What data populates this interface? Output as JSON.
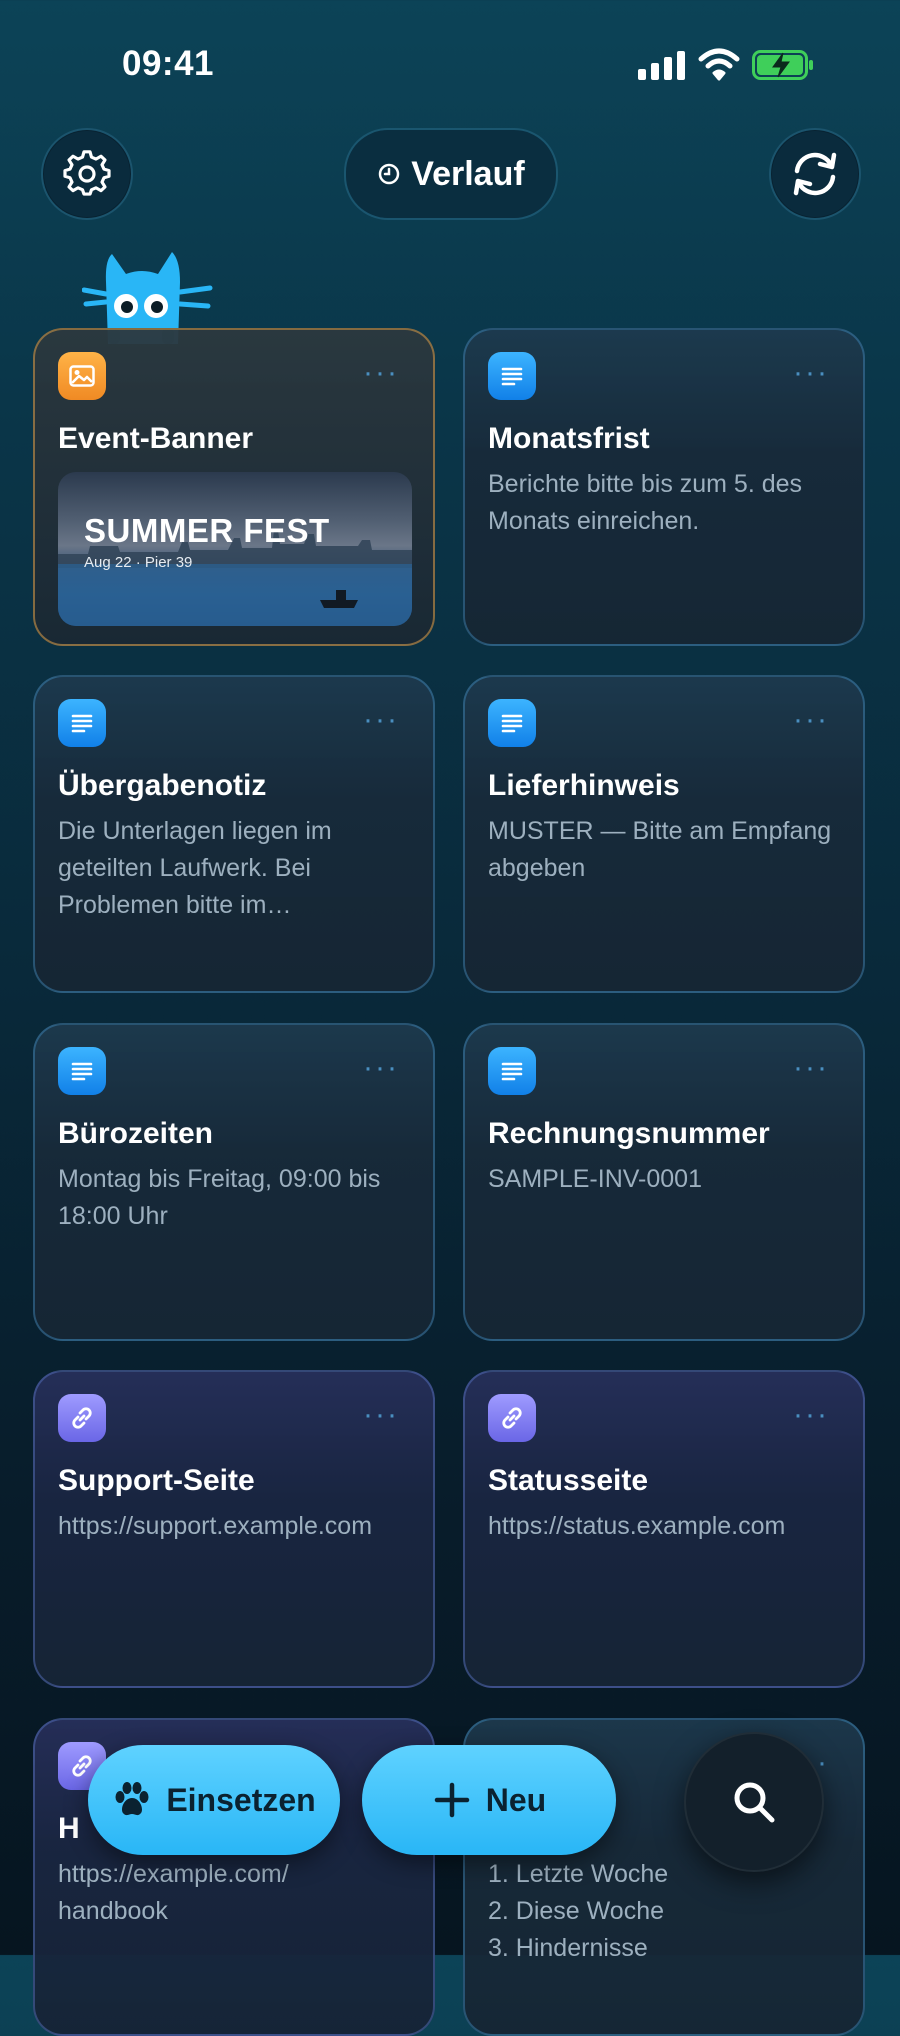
{
  "status_bar": {
    "time": "09:41"
  },
  "header": {
    "history_label": "Verlauf"
  },
  "cards": [
    {
      "title": "Event-Banner",
      "type": "image",
      "image": {
        "headline": "SUMMER FEST",
        "subline": "Aug 22  ·  Pier 39"
      }
    },
    {
      "title": "Monatsfrist",
      "type": "text",
      "body": "Berichte bitte bis zum 5. des Monats einreichen."
    },
    {
      "title": "Übergabenotiz",
      "type": "text",
      "body": "Die Unterlagen liegen im geteilten Laufwerk. Bei Problemen bitte im Bereitschaftskanal melden."
    },
    {
      "title": "Lieferhinweis",
      "type": "text",
      "body": "MUSTER — Bitte am Empfang abgeben"
    },
    {
      "title": "Bürozeiten",
      "type": "text",
      "body": "Montag bis Freitag, 09:00 bis 18:00 Uhr"
    },
    {
      "title": "Rechnungsnummer",
      "type": "text",
      "body": "SAMPLE-INV-0001"
    },
    {
      "title": "Support-Seite",
      "type": "link",
      "body": "https://support.example.com"
    },
    {
      "title": "Statusseite",
      "type": "link",
      "body": "https://status.example.com"
    },
    {
      "title": "H",
      "type": "link",
      "body": "https://example.com/\nhandbook"
    },
    {
      "title": "",
      "type": "text",
      "body": "1. Letzte Woche\n2. Diese Woche\n3. Hindernisse"
    }
  ],
  "bottom_bar": {
    "paste_label": "Einsetzen",
    "new_label": "Neu"
  },
  "colors": {
    "accent": "#29b6f6",
    "text_icon": "#1180e8",
    "image_icon": "#f08a24",
    "link_icon": "#6a66e6"
  }
}
